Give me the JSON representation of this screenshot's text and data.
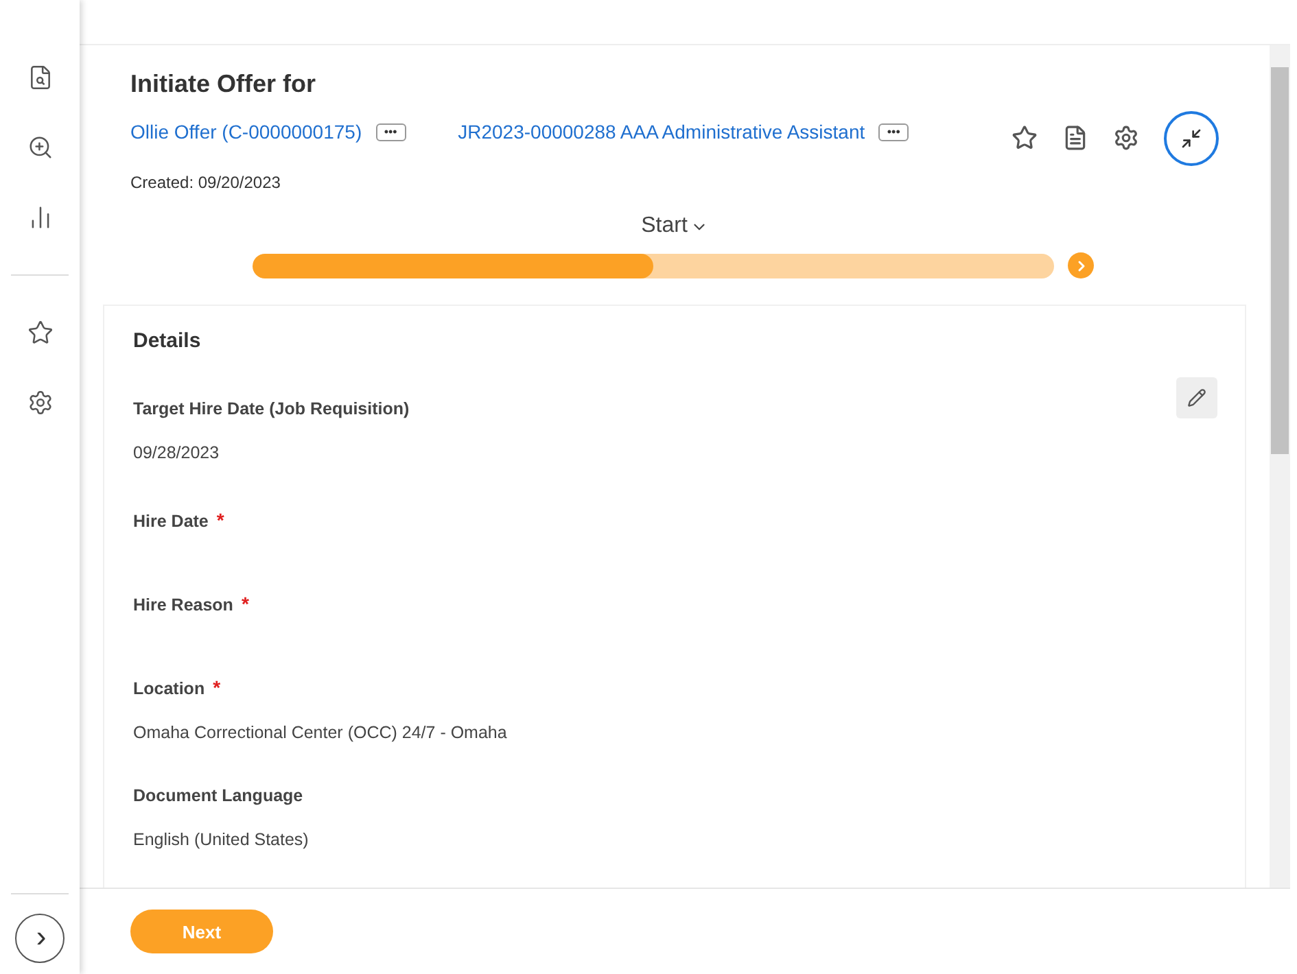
{
  "sidebar": {
    "items": [
      {
        "kind": "profile-search"
      },
      {
        "kind": "zoom-person"
      },
      {
        "kind": "chart"
      },
      {
        "kind": "divider"
      },
      {
        "kind": "star"
      },
      {
        "kind": "gear"
      }
    ],
    "expand_button": "›"
  },
  "header": {
    "title": "Initiate Offer for",
    "links": [
      {
        "text": "Ollie Offer (C-0000000175)",
        "menu": "•••"
      },
      {
        "text": "JR2023-00000288 AAA Administrative Assistant",
        "menu": "•••"
      }
    ],
    "created": "Created: 09/20/2023",
    "actions": [
      {
        "kind": "star"
      },
      {
        "kind": "pdf"
      },
      {
        "kind": "gear"
      },
      {
        "kind": "collapse"
      }
    ]
  },
  "progress": {
    "step": "Start",
    "level": 0.5
  },
  "details": {
    "title": "Details",
    "required_symbol": "*",
    "fields": [
      {
        "label": "Target Hire Date (Job Requisition)",
        "required": false,
        "value": "09/28/2023",
        "editable": true
      },
      {
        "label": "Hire Date",
        "required": true,
        "editable": false
      },
      {
        "label": "Hire Reason",
        "required": true,
        "editable": false
      },
      {
        "label": "Location",
        "required": true,
        "value": "Omaha Correctional Center (OCC) 24/7 - Omaha",
        "editable": false
      },
      {
        "label": "Document Language",
        "required": false,
        "value": "English (United States)",
        "editable": false
      }
    ]
  },
  "footer": {
    "button": "Next"
  }
}
